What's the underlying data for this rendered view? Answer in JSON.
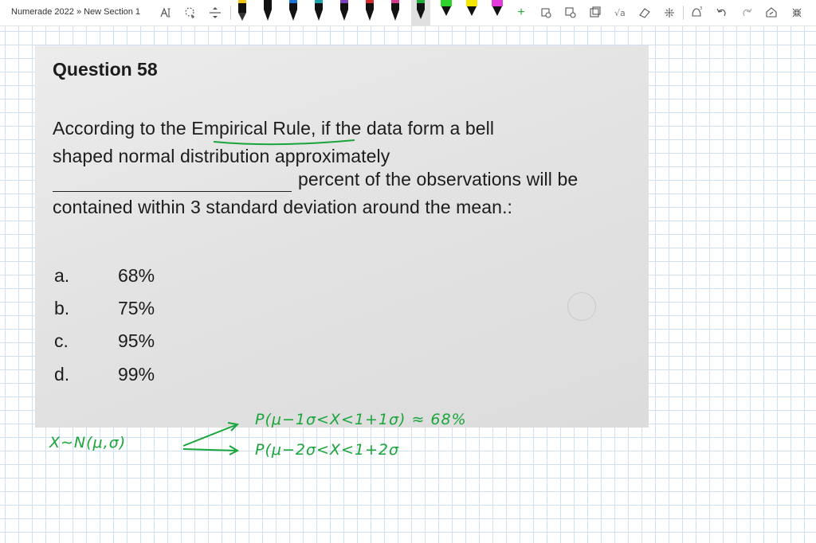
{
  "app": {
    "breadcrumb": "Numerade 2022 » New Section 1"
  },
  "toolbar": {
    "tools": [
      "lasso-type-icon",
      "lasso-select-icon",
      "insert-space-icon"
    ],
    "pens": [
      {
        "name": "black-pen",
        "color": "#111111"
      },
      {
        "name": "black-pen-2",
        "color": "#111111"
      },
      {
        "name": "blue-pen",
        "color": "#1e73d8"
      },
      {
        "name": "teal-pen",
        "color": "#1aa4b0"
      },
      {
        "name": "purple-pen",
        "color": "#7b3fc4"
      },
      {
        "name": "red-pen",
        "color": "#d42a2a"
      },
      {
        "name": "pink-pen",
        "color": "#d63a8a"
      },
      {
        "name": "green-pen-selected",
        "color": "#22aa3a"
      },
      {
        "name": "green-highlighter",
        "color": "#2fd12f"
      },
      {
        "name": "yellow-highlighter",
        "color": "#f6e500"
      },
      {
        "name": "magenta-highlighter",
        "color": "#e23ad8"
      }
    ],
    "add_pen_label": "+",
    "right_tools": [
      "ink-to-shape-icon",
      "ink-to-text-icon",
      "lasso-icon",
      "math-icon",
      "eraser-icon",
      "ruler-icon",
      "ink-replay-icon",
      "undo-icon",
      "redo-icon",
      "share-icon",
      "collapse-icon"
    ]
  },
  "question": {
    "title": "Question 58",
    "lines": [
      "According to the Empirical Rule, if the data form a bell",
      "shaped normal distribution approximately",
      "percent of the observations will be",
      "contained within 3 standard deviation around the mean.:"
    ],
    "options": [
      {
        "letter": "a.",
        "value": "68%"
      },
      {
        "letter": "b.",
        "value": "75%"
      },
      {
        "letter": "c.",
        "value": "95%"
      },
      {
        "letter": "d.",
        "value": "99%"
      }
    ]
  },
  "ink": {
    "distribution": "X∼N(μ,σ)",
    "line1": "P(μ−1σ<X<1+1σ) ≈ 68%",
    "line2": "P(μ−2σ<X<1+2σ",
    "color": "#1aa53a"
  }
}
